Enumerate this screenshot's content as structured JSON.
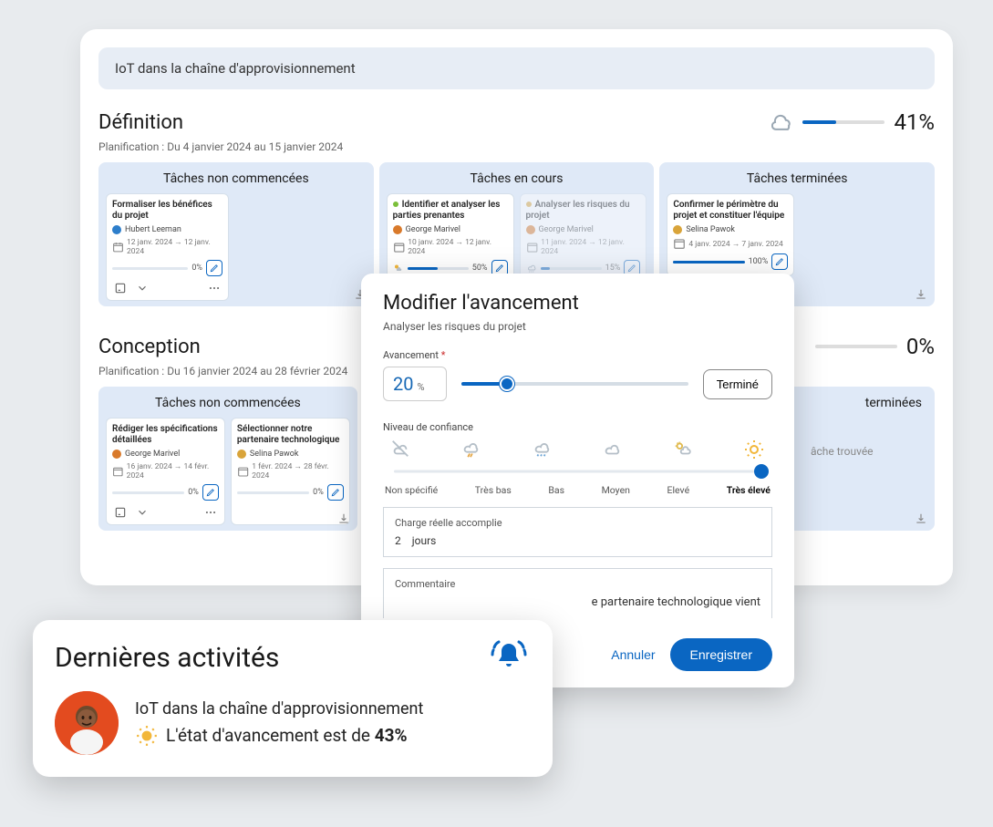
{
  "project_title": "IoT dans la chaîne d'approvisionnement",
  "sections": {
    "definition": {
      "title": "Définition",
      "subtitle": "Planification : Du 4 janvier 2024 au 15 janvier 2024",
      "progress_pct": "41%",
      "progress_fill": 41,
      "weather_icon": "cloud-icon",
      "columns": {
        "not_started": {
          "title": "Tâches non commencées",
          "tasks": [
            {
              "title": "Formaliser les bénéfices du projet",
              "assignee": "Hubert Leeman",
              "avatar_color": "#2d7ecb",
              "dates": "12 janv. 2024 → 12 janv. 2024",
              "pct": "0%"
            }
          ]
        },
        "in_progress": {
          "title": "Tâches en cours",
          "tasks": [
            {
              "dot": "#7bbf3a",
              "title": "Identifier et analyser les parties prenantes",
              "assignee": "George Marivel",
              "avatar_color": "#d97a2b",
              "dates": "10 janv. 2024 → 12 janv. 2024",
              "pct": "50%",
              "pfill": 50,
              "weather_icon": "sun-cloud-icon"
            },
            {
              "dot": "#d9a43a",
              "dim": true,
              "title": "Analyser les risques du projet",
              "assignee": "George Marivel",
              "avatar_color": "#d97a2b",
              "dates": "11 janv. 2024 → 12 janv. 2024",
              "pct": "15%",
              "pfill": 15,
              "weather_icon": "cloud-rain-icon"
            }
          ]
        },
        "done": {
          "title": "Tâches terminées",
          "tasks": [
            {
              "title": "Confirmer le périmètre du projet et constituer l'équipe",
              "assignee": "Selina Pawok",
              "avatar_color": "#d9a43a",
              "dates": "4 janv. 2024 → 7 janv. 2024",
              "pct": "100%",
              "pfill": 100
            }
          ]
        }
      }
    },
    "conception": {
      "title": "Conception",
      "subtitle": "Planification : Du 16 janvier 2024 au 28 février 2024",
      "progress_pct": "0%",
      "progress_fill": 0,
      "columns": {
        "not_started": {
          "title": "Tâches non commencées",
          "tasks": [
            {
              "title": "Rédiger les spécifications détaillées",
              "assignee": "George Marivel",
              "avatar_color": "#d97a2b",
              "dates": "16 janv. 2024 → 14 févr. 2024",
              "pct": "0%"
            },
            {
              "title": "Sélectionner notre partenaire technologique",
              "assignee": "Selina Pawok",
              "avatar_color": "#d9a43a",
              "dates": "1 févr. 2024 → 28 févr. 2024",
              "pct": "0%"
            }
          ]
        },
        "done": {
          "title_suffix": "terminées",
          "empty_text": "âche trouvée"
        }
      }
    }
  },
  "modal": {
    "title": "Modifier l'avancement",
    "subtitle": "Analyser les risques du projet",
    "field_adv": "Avancement",
    "adv_value": "20",
    "adv_unit": "%",
    "adv_fill": 20,
    "terminate_btn": "Terminé",
    "confidence_label": "Niveau de confiance",
    "confidence_levels": [
      "Non spécifié",
      "Très bas",
      "Bas",
      "Moyen",
      "Elevé",
      "Très élevé"
    ],
    "confidence_selected_index": 5,
    "workload_label": "Charge réelle accomplie",
    "workload_value": "2",
    "workload_unit": "jours",
    "comment_label": "Commentaire",
    "comment_fragment": "e partenaire technologique vient",
    "cancel": "Annuler",
    "save": "Enregistrer"
  },
  "toast": {
    "title": "Dernières activités",
    "project": "IoT dans la chaîne d'approvisionnement",
    "status_prefix": "L'état d'avancement est de ",
    "status_pct": "43%"
  }
}
